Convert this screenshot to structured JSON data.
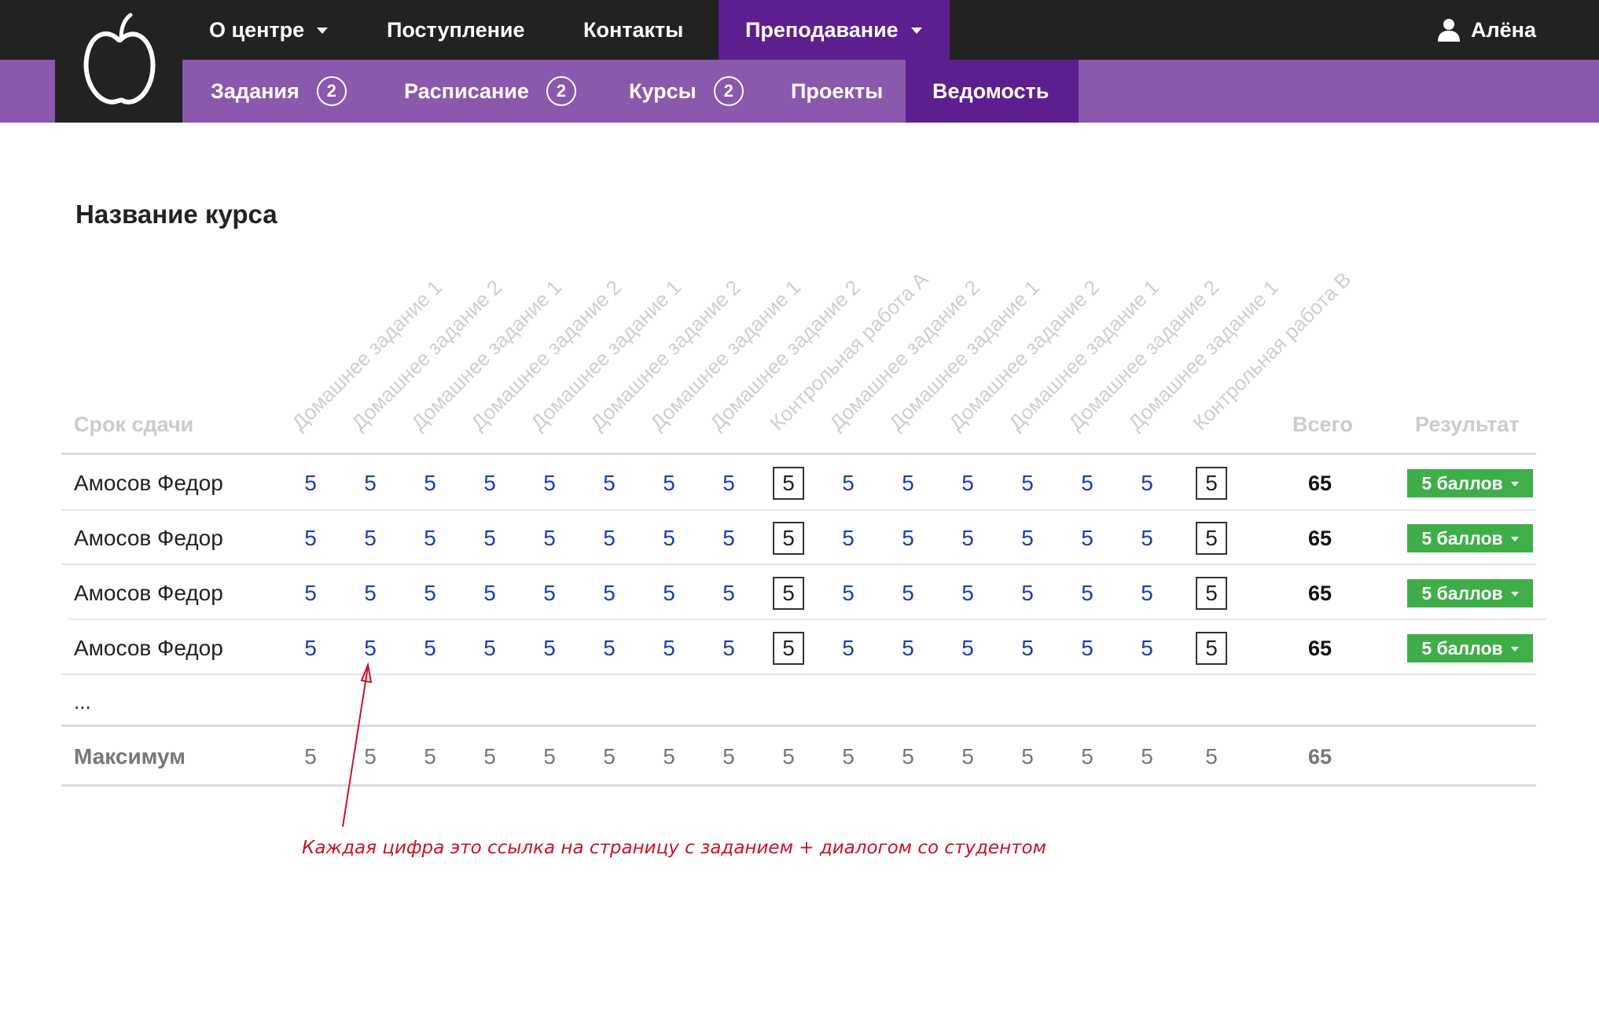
{
  "nav": {
    "items": [
      {
        "label": "О центре",
        "has_caret": true
      },
      {
        "label": "Поступление",
        "has_caret": false
      },
      {
        "label": "Контакты",
        "has_caret": false
      },
      {
        "label": "Преподавание",
        "has_caret": true,
        "active": true
      }
    ],
    "user_name": "Алёна",
    "user_icon": "user-icon",
    "logo_icon": "apple-logo-icon"
  },
  "subnav": {
    "items": [
      {
        "label": "Задания",
        "badge": "2"
      },
      {
        "label": "Расписание",
        "badge": "2"
      },
      {
        "label": "Курсы",
        "badge": "2"
      },
      {
        "label": "Проекты",
        "badge": ""
      },
      {
        "label": "Ведомость",
        "badge": "",
        "active": true
      }
    ]
  },
  "page": {
    "title": "Название курса",
    "deadline_label": "Срок сдачи",
    "total_label": "Всего",
    "result_label": "Результат"
  },
  "columns": [
    "Домашнее задание 1",
    "Домашнее задание 2",
    "Домашнее задание 1",
    "Домашнее задание 2",
    "Домашнее задание 1",
    "Домашнее задание 2",
    "Домашнее задание 1",
    "Домашнее задание 2",
    "Контрольная работа A",
    "Домашнее задание 2",
    "Домашнее задание 1",
    "Домашнее задание 2",
    "Домашнее задание 1",
    "Домашнее задание 2",
    "Домашнее задание 1",
    "Контрольная работа B"
  ],
  "boxed_columns": [
    8,
    15
  ],
  "rows": [
    {
      "student": "Амосов Федор",
      "grades": [
        "5",
        "5",
        "5",
        "5",
        "5",
        "5",
        "5",
        "5",
        "5",
        "5",
        "5",
        "5",
        "5",
        "5",
        "5",
        "5"
      ],
      "total": "65",
      "result": "5 баллов"
    },
    {
      "student": "Амосов Федор",
      "grades": [
        "5",
        "5",
        "5",
        "5",
        "5",
        "5",
        "5",
        "5",
        "5",
        "5",
        "5",
        "5",
        "5",
        "5",
        "5",
        "5"
      ],
      "total": "65",
      "result": "5 баллов"
    },
    {
      "student": "Амосов Федор",
      "grades": [
        "5",
        "5",
        "5",
        "5",
        "5",
        "5",
        "5",
        "5",
        "5",
        "5",
        "5",
        "5",
        "5",
        "5",
        "5",
        "5"
      ],
      "total": "65",
      "result": "5 баллов"
    },
    {
      "student": "Амосов Федор",
      "grades": [
        "5",
        "5",
        "5",
        "5",
        "5",
        "5",
        "5",
        "5",
        "5",
        "5",
        "5",
        "5",
        "5",
        "5",
        "5",
        "5"
      ],
      "total": "65",
      "result": "5 баллов"
    }
  ],
  "ellipsis": "...",
  "maximum": {
    "label": "Максимум",
    "grades": [
      "5",
      "5",
      "5",
      "5",
      "5",
      "5",
      "5",
      "5",
      "5",
      "5",
      "5",
      "5",
      "5",
      "5",
      "5",
      "5"
    ],
    "total": "65"
  },
  "annotation": {
    "text": "Каждая цифра это ссылка на страницу с заданием + диалогом со студентом",
    "color": "#cc1122"
  },
  "colors": {
    "topbar": "#222222",
    "subbar": "#8a58ad",
    "active": "#5d1e8f",
    "link": "#1a3db8",
    "result_button": "#3fae49"
  }
}
